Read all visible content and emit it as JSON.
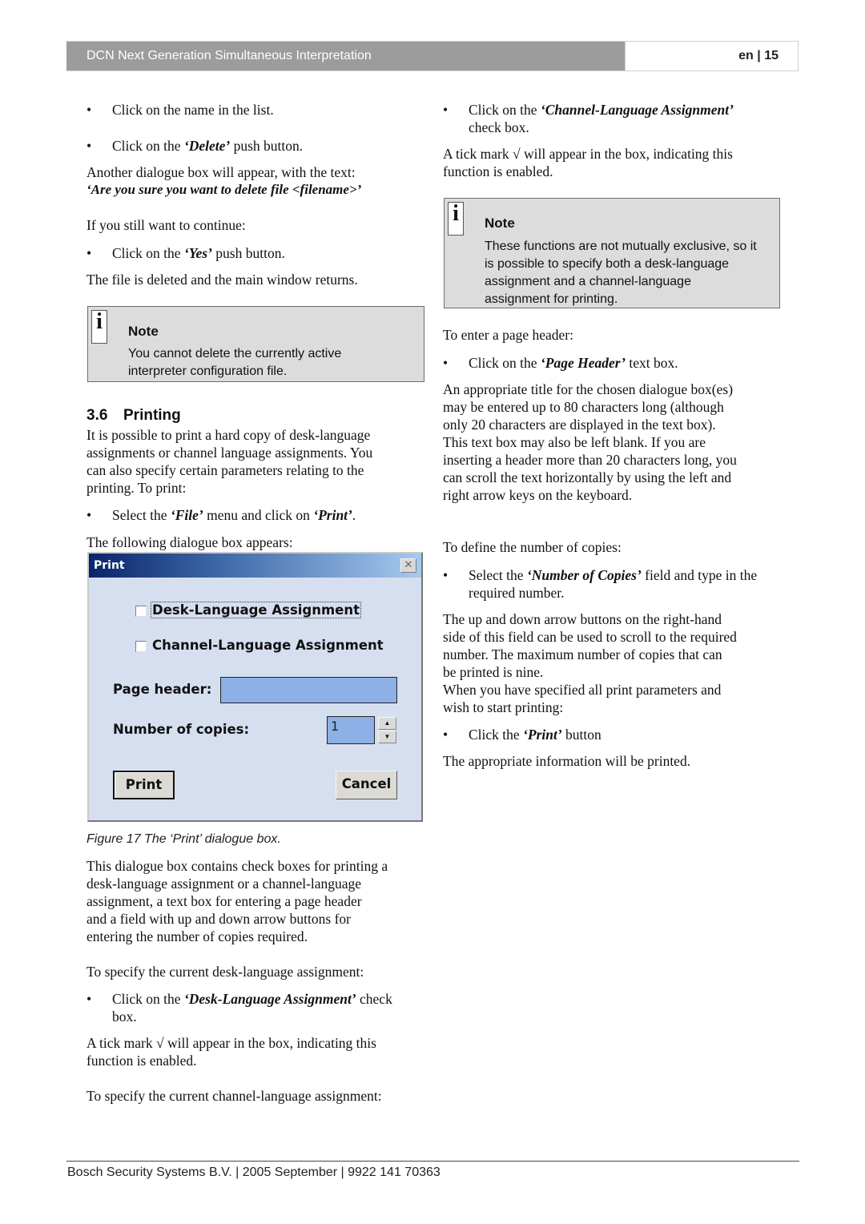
{
  "header": {
    "title": "DCN Next Generation Simultaneous Interpretation",
    "page": "en | 15"
  },
  "left": {
    "bullet1": "Click on the name in the list.",
    "bullet2_pre": "Click on the ",
    "bullet2_em": "‘Delete’",
    "bullet2_post": " push button.",
    "para1": "Another dialogue box will appear, with the text:",
    "para1_em": "‘Are you sure you want to delete file <filename>’",
    "para2": "If you still want to continue:",
    "bullet3_pre": "Click on the ",
    "bullet3_em": "‘Yes’",
    "bullet3_post": " push button.",
    "para3": "The file is deleted and the main window returns.",
    "note": {
      "icon": "i",
      "title": "Note",
      "lines": [
        "You cannot delete the currently active",
        "interpreter configuration file."
      ]
    },
    "section": {
      "number": "3.6",
      "title": "Printing"
    },
    "intro_lines": [
      "It is possible to print a hard copy of desk-language",
      "assignments or channel language assignments. You",
      "can also specify certain parameters relating to the",
      "printing. To print:"
    ],
    "bullet4_pre": "Select the ",
    "bullet4_em1": "‘File’",
    "bullet4_mid": " menu and click on ",
    "bullet4_em2": "‘Print’",
    "bullet4_post": ".",
    "para4": "The following dialogue box appears:",
    "caption": "Figure 17 The ‘Print’ dialogue box.",
    "desc_lines": [
      "This dialogue box contains check boxes for printing a",
      "desk-language assignment or a channel-language",
      "assignment, a text box for entering a page header",
      "and a field with up and down arrow buttons for",
      "entering the number of copies required."
    ],
    "para5": "To specify the current desk-language assignment:",
    "bullet5_pre": "Click on the ",
    "bullet5_em": "‘Desk-Language Assignment’",
    "bullet5_post": " check",
    "bullet5_line2": "box.",
    "tick_lines": [
      "A tick mark √ will appear in the box, indicating this",
      "function is enabled."
    ],
    "para6": "To specify the current channel-language assignment:"
  },
  "dialog": {
    "title": "Print",
    "close_glyph": "✕",
    "checkbox1": {
      "label": "Desk-Language Assignment",
      "checked": false
    },
    "checkbox2": {
      "label": "Channel-Language Assignment",
      "checked": false
    },
    "page_header_label": "Page header:",
    "page_header_value": "",
    "copies_label": "Number of copies:",
    "copies_value": "1",
    "spin_up": "▲",
    "spin_down": "▼",
    "print_button": "Print",
    "cancel_button": "Cancel"
  },
  "right": {
    "bullet1_pre": "Click on the ",
    "bullet1_em": "‘Channel-Language Assignment’",
    "bullet1_line2": "check box.",
    "tick_lines": [
      "A tick mark √ will appear in the box, indicating this",
      "function is enabled."
    ],
    "note": {
      "icon": "i",
      "title": "Note",
      "lines": [
        "These functions are not mutually exclusive, so it",
        "is possible to specify both a desk-language",
        "assignment and a channel-language",
        "assignment for printing."
      ]
    },
    "para1": "To enter a page header:",
    "bullet2_pre": "Click on the ",
    "bullet2_em": "‘Page Header’",
    "bullet2_post": " text box.",
    "header_lines": [
      "An appropriate title for the chosen dialogue box(es)",
      "may be entered up to 80 characters long (although",
      "only 20 characters are displayed in the text box).",
      "This text box may also be left blank. If you are",
      "inserting a header more than 20 characters long, you",
      "can scroll the text horizontally by using the left and",
      "right arrow keys on the keyboard."
    ],
    "para2": "To define the number of copies:",
    "bullet3_pre": "Select the ",
    "bullet3_em": "‘Number of Copies’",
    "bullet3_post": " field and type in the",
    "bullet3_line2": "required number.",
    "copies_lines": [
      "The up and down arrow buttons on the right-hand",
      "side of this field can be used to scroll to the required",
      "number. The maximum number of copies that can",
      "be printed is nine.",
      "When you have specified all print parameters and",
      "wish to start printing:"
    ],
    "bullet4_pre": "Click the ",
    "bullet4_em": "‘Print’",
    "bullet4_post": " button",
    "para3": "The appropriate information will be printed."
  },
  "footer": {
    "text": "Bosch Security Systems B.V. | 2005 September | 9922 141 70363"
  }
}
